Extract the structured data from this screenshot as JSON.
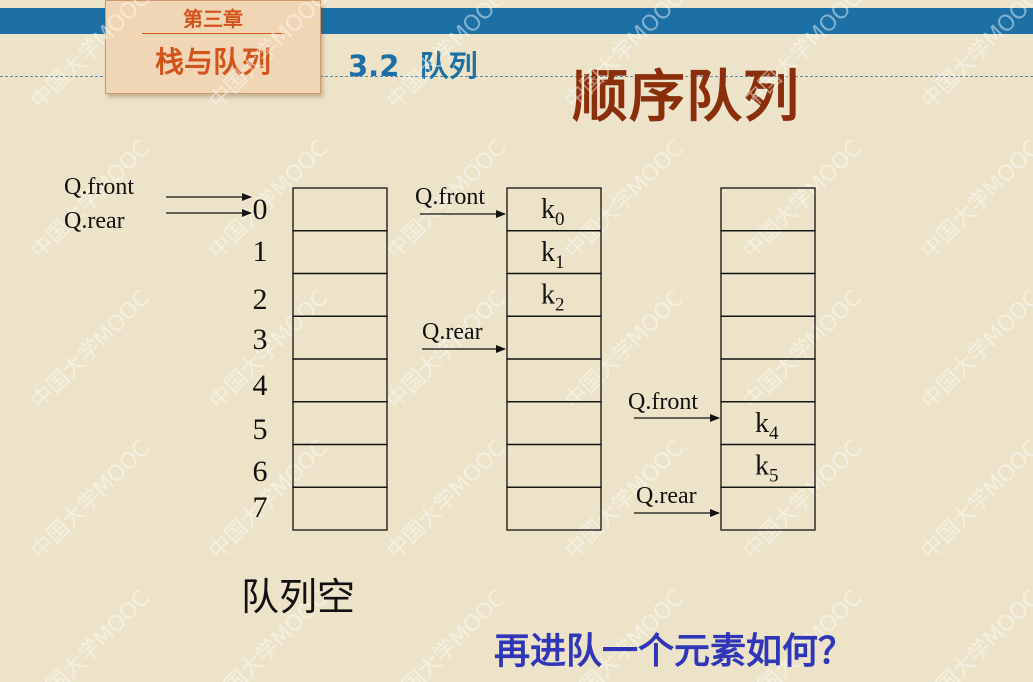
{
  "header": {
    "chapter_number": "第三章",
    "chapter_title": "栈与队列",
    "section": "3.2  队列"
  },
  "title": "顺序队列",
  "status_text": "队列空",
  "question_text": "再进队一个元素如何？",
  "watermark_text": "中国大学MOOC",
  "diagram": {
    "index_labels": [
      "0",
      "1",
      "2",
      "3",
      "4",
      "5",
      "6",
      "7"
    ],
    "queues": [
      {
        "cells": [
          "",
          "",
          "",
          "",
          "",
          "",
          "",
          ""
        ],
        "pointers": [
          {
            "label": "Q.front",
            "index": 0
          },
          {
            "label": "Q.rear",
            "index": 0
          }
        ]
      },
      {
        "cells": [
          {
            "base": "k",
            "sub": "0"
          },
          {
            "base": "k",
            "sub": "1"
          },
          {
            "base": "k",
            "sub": "2"
          },
          "",
          "",
          "",
          "",
          ""
        ],
        "pointers": [
          {
            "label": "Q.front",
            "index": 0
          },
          {
            "label": "Q.rear",
            "index": 3
          }
        ]
      },
      {
        "cells": [
          "",
          "",
          "",
          "",
          "",
          {
            "base": "k",
            "sub": "4"
          },
          {
            "base": "k",
            "sub": "5"
          },
          ""
        ],
        "pointers": [
          {
            "label": "Q.front",
            "index": 5
          },
          {
            "label": "Q.rear",
            "index": 7
          }
        ]
      }
    ]
  },
  "colors": {
    "background": "#ece3c9",
    "top_bar": "#1c70a6",
    "chapter_text": "#d2541c",
    "title": "#8a2e0c",
    "question": "#2f37b8"
  }
}
